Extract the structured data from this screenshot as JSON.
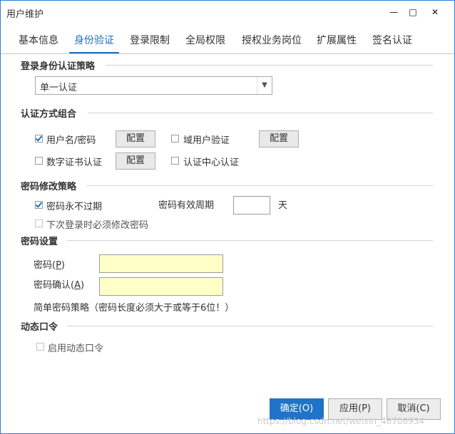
{
  "window": {
    "title": "用户维护",
    "minimize": "—",
    "maximize": "□",
    "close": "✕"
  },
  "tabs": [
    {
      "label": "基本信息"
    },
    {
      "label": "身份验证"
    },
    {
      "label": "登录限制"
    },
    {
      "label": "全局权限"
    },
    {
      "label": "授权业务岗位"
    },
    {
      "label": "扩展属性"
    },
    {
      "label": "签名认证"
    }
  ],
  "auth_policy": {
    "title": "登录身份认证策略",
    "selected": "单一认证"
  },
  "auth_methods": {
    "title": "认证方式组合",
    "username_password": "用户名/密码",
    "domain_user": "域用户验证",
    "digital_cert": "数字证书认证",
    "auth_center": "认证中心认证",
    "config_label": "配置"
  },
  "password_change": {
    "title": "密码修改策略",
    "never_expire": "密码永不过期",
    "validity_period": "密码有效周期",
    "validity_value": "",
    "unit_day": "天",
    "must_change": "下次登录时必须修改密码"
  },
  "password_settings": {
    "title": "密码设置",
    "password_label": "密码(",
    "password_key": "P",
    "password_end": ")",
    "confirm_label": "密码确认(",
    "confirm_key": "A",
    "confirm_end": ")",
    "simple_policy": "简单密码策略（密码长度必须大于或等于6位！）"
  },
  "dynamic_token": {
    "title": "动态口令",
    "enable": "启用动态口令"
  },
  "footer": {
    "ok": "确定(O)",
    "apply": "应用(P)",
    "cancel": "取消(C)"
  },
  "watermark": "https://blog.csdn.net/weixin_46706934"
}
